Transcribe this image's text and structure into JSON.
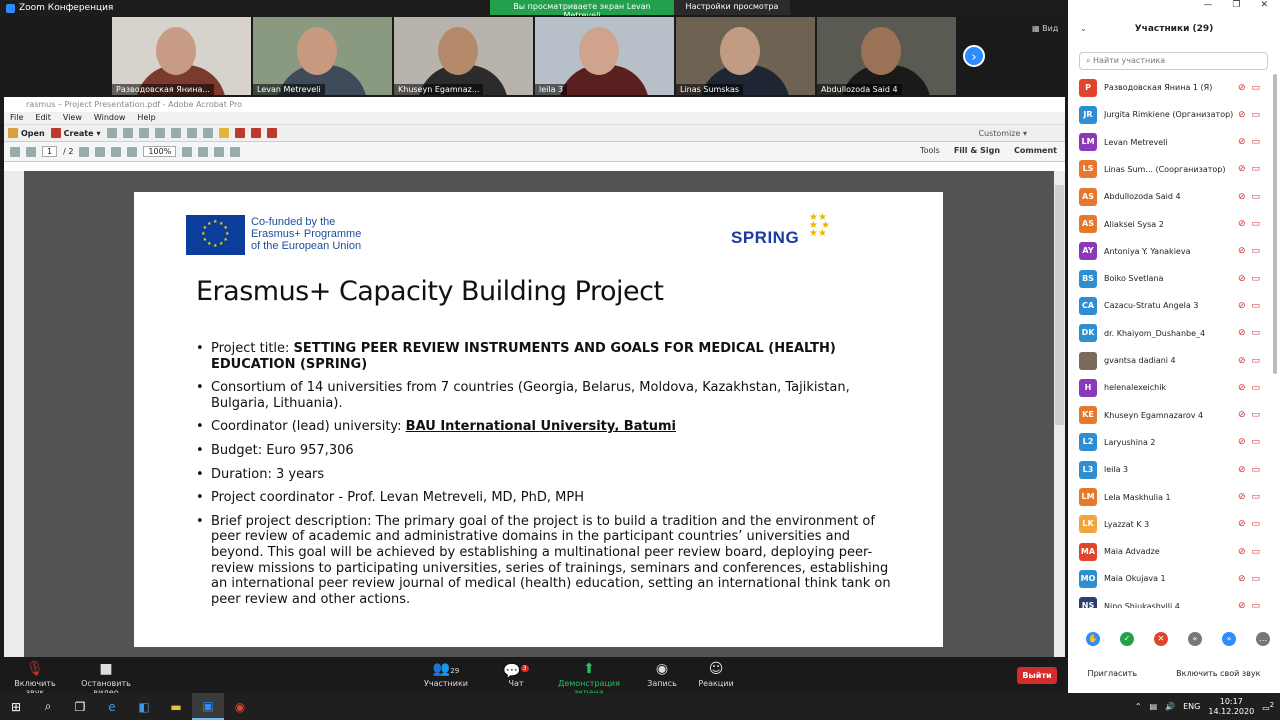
{
  "zoom": {
    "title": "Zoom Конференция",
    "share_status": "Вы просматриваете экран Levan Metreveli",
    "view_options": "Настройки просмотра",
    "view_label": "Вид"
  },
  "video_tiles": [
    {
      "name": "Разводовская Янина...",
      "bg": "#d8d2cc",
      "skin": "#c89b85",
      "shirt": "#7a3b2e"
    },
    {
      "name": "Levan Metreveli",
      "bg": "#8a9a80",
      "skin": "#c79a80",
      "shirt": "#3f4a5a"
    },
    {
      "name": "Khuseyn Egamnaz...",
      "bg": "#b8b4ad",
      "skin": "#b58a6a",
      "shirt": "#2b2b2b"
    },
    {
      "name": "leila 3",
      "bg": "#b7c0c8",
      "skin": "#d0a48c",
      "shirt": "#5a1f1f"
    },
    {
      "name": "Linas Sumskas",
      "bg": "#6e6252",
      "skin": "#c19c82",
      "shirt": "#1f2633"
    },
    {
      "name": "Abdullozoda Said 4",
      "bg": "#5a5a52",
      "skin": "#9a7256",
      "shirt": "#1a1a1a"
    }
  ],
  "acrobat": {
    "title": "rasmus – Project Presentation.pdf - Adobe Acrobat Pro",
    "menu": [
      "File",
      "Edit",
      "View",
      "Window",
      "Help"
    ],
    "open_label": "Open",
    "create_label": "Create",
    "customize_label": "Customize",
    "page_current": "1",
    "page_total": "/ 2",
    "zoom": "100%",
    "tools_label": "Tools",
    "fill_sign_label": "Fill & Sign",
    "comment_label": "Comment"
  },
  "slide": {
    "eu_text": [
      "Co-funded by the",
      "Erasmus+ Programme",
      "of the European Union"
    ],
    "logo": "SPRING",
    "title": "Erasmus+ Capacity Building Project",
    "b1_prefix": "Project title: ",
    "b1_bold": "SETTING PEER REVIEW INSTRUMENTS AND GOALS FOR MEDICAL (HEALTH) EDUCATION (SPRING)",
    "b2": "Consortium of 14 universities from 7 countries (Georgia, Belarus, Moldova, Kazakhstan, Tajikistan, Bulgaria, Lithuania).",
    "b3_prefix": "Coordinator (lead) university: ",
    "b3_bold": "BAU International University, Batumi",
    "b4": "Budget: Euro 957,306",
    "b5": "Duration: 3 years",
    "b6": "Project coordinator - Prof. Levan Metreveli, MD, PhD, MPH",
    "b7": "Brief project description: The primary goal of the project is to build a tradition and the environment of peer review of academic and administrative domains in the participant countries’ universities and beyond. This goal will be achieved by establishing a multinational peer review board, deploying peer- review missions to participating universities, series of trainings, seminars and conferences, establishing an international peer review journal of medical (health) education, setting an international think tank on peer review and other actions."
  },
  "bottom_bar": {
    "unmute": "Включить звук",
    "start_video": "Остановить видео",
    "participants": "Участники",
    "participants_count": "29",
    "chat": "Чат",
    "chat_badge": "3",
    "share": "Демонстрация экрана",
    "record": "Запись",
    "reactions": "Реакции",
    "leave": "Выйти"
  },
  "panel": {
    "title": "Участники (29)",
    "search_placeholder": "Найти участника",
    "participants": [
      {
        "initials": "P",
        "name": "Разводовская Янина 1 (Я)",
        "color": "#e0452c"
      },
      {
        "initials": "JR",
        "name": "Jurgita Rimkiene (Организатор)",
        "color": "#2f8ed1"
      },
      {
        "initials": "LM",
        "name": "Levan Metreveli",
        "color": "#8a3ab9"
      },
      {
        "initials": "LS",
        "name": "Linas Sum... (Соорганизатор)",
        "color": "#e8772e"
      },
      {
        "initials": "AS",
        "name": "Abdullozoda Said 4",
        "color": "#e8772e"
      },
      {
        "initials": "AS",
        "name": "Aliaksei Sysa 2",
        "color": "#e8772e"
      },
      {
        "initials": "AY",
        "name": "Antoniya Y. Yanakieva",
        "color": "#8a3ab9"
      },
      {
        "initials": "BS",
        "name": "Boiko Svetlana",
        "color": "#2f8ed1"
      },
      {
        "initials": "CA",
        "name": "Cazacu-Stratu Angela 3",
        "color": "#2f8ed1"
      },
      {
        "initials": "DK",
        "name": "dr. Khaiyom_Dushanbe_4",
        "color": "#2f8ed1"
      },
      {
        "initials": "",
        "name": "gvantsa dadiani 4",
        "color": "#7a6a5a"
      },
      {
        "initials": "H",
        "name": "helenalexeichik",
        "color": "#8a3ab9"
      },
      {
        "initials": "KE",
        "name": "Khuseyn Egamnazarov 4",
        "color": "#e8772e"
      },
      {
        "initials": "L2",
        "name": "Laryushina 2",
        "color": "#2f8ed1"
      },
      {
        "initials": "L3",
        "name": "leila 3",
        "color": "#2f8ed1"
      },
      {
        "initials": "LM",
        "name": "Lela Maskhulia 1",
        "color": "#e8772e"
      },
      {
        "initials": "LK",
        "name": "Lyazzat K 3",
        "color": "#f0a43a"
      },
      {
        "initials": "MA",
        "name": "Maia Advadze",
        "color": "#e0452c"
      },
      {
        "initials": "MO",
        "name": "Maia Okujava 1",
        "color": "#2f8ed1"
      },
      {
        "initials": "NS",
        "name": "Nino Shiukashvili 4",
        "color": "#2a3f6a"
      }
    ],
    "invite": "Пригласить",
    "unmute_me": "Включить свой звук"
  },
  "taskbar": {
    "lang": "ENG",
    "time": "10:17",
    "date": "14.12.2020",
    "notif": "2"
  }
}
